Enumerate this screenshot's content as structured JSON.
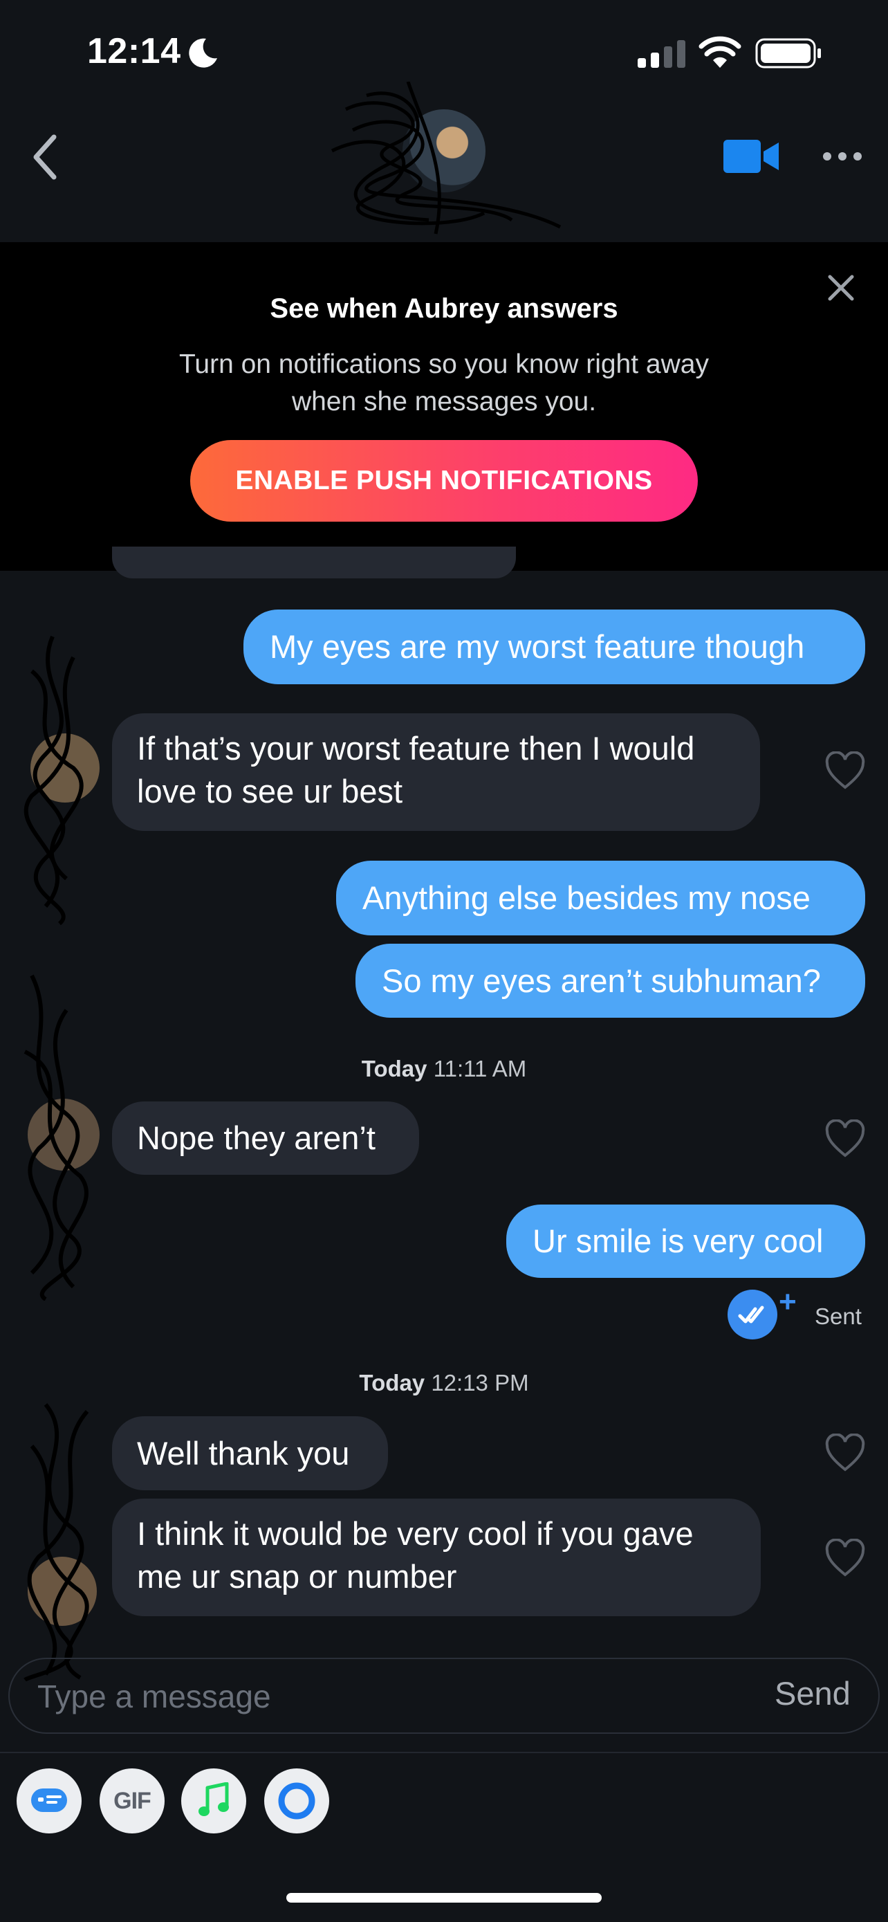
{
  "status_bar": {
    "time": "12:14"
  },
  "icons": {
    "back": "chevron-left-icon",
    "video": "video-call-icon",
    "more": "more-dots-icon",
    "close": "close-icon",
    "heart": "heart-outline-icon",
    "moon": "moon-icon",
    "signal": "cell-signal-icon",
    "wifi": "wifi-icon",
    "battery": "battery-icon",
    "read_receipt": "double-check-icon",
    "sticker": "sticker-icon",
    "music": "music-note-icon",
    "loop": "loop-icon"
  },
  "banner": {
    "title": "See when Aubrey answers",
    "text": "Turn on notifications so you know right away when she messages you.",
    "button_label": "ENABLE PUSH NOTIFICATIONS"
  },
  "messages": [
    {
      "dir": "sent",
      "text": "My eyes are my worst feature though"
    },
    {
      "dir": "received",
      "text": "If that’s your worst feature then I would love to see ur best"
    },
    {
      "dir": "sent",
      "text": "Anything else besides my nose"
    },
    {
      "dir": "sent",
      "text": "So my eyes aren’t subhuman?"
    },
    {
      "dir": "received",
      "text": "Nope they aren’t"
    },
    {
      "dir": "sent",
      "text": "Ur smile is very cool"
    },
    {
      "dir": "received",
      "text": "Well thank you"
    },
    {
      "dir": "received",
      "text": "I think it would be very cool if you gave me ur snap or number"
    }
  ],
  "timestamps": [
    {
      "day": "Today",
      "time": "11:11 AM"
    },
    {
      "day": "Today",
      "time": "12:13 PM"
    }
  ],
  "sent_status": "Sent",
  "composer": {
    "placeholder": "Type a message",
    "send_label": "Send",
    "gif_label": "GIF"
  },
  "colors": {
    "background": "#111418",
    "sent_bubble": "#4ea6f7",
    "received_bubble": "#252932",
    "accent_blue": "#3b8df0",
    "gradient_start": "#fd6a3a",
    "gradient_end": "#fe2a83"
  }
}
